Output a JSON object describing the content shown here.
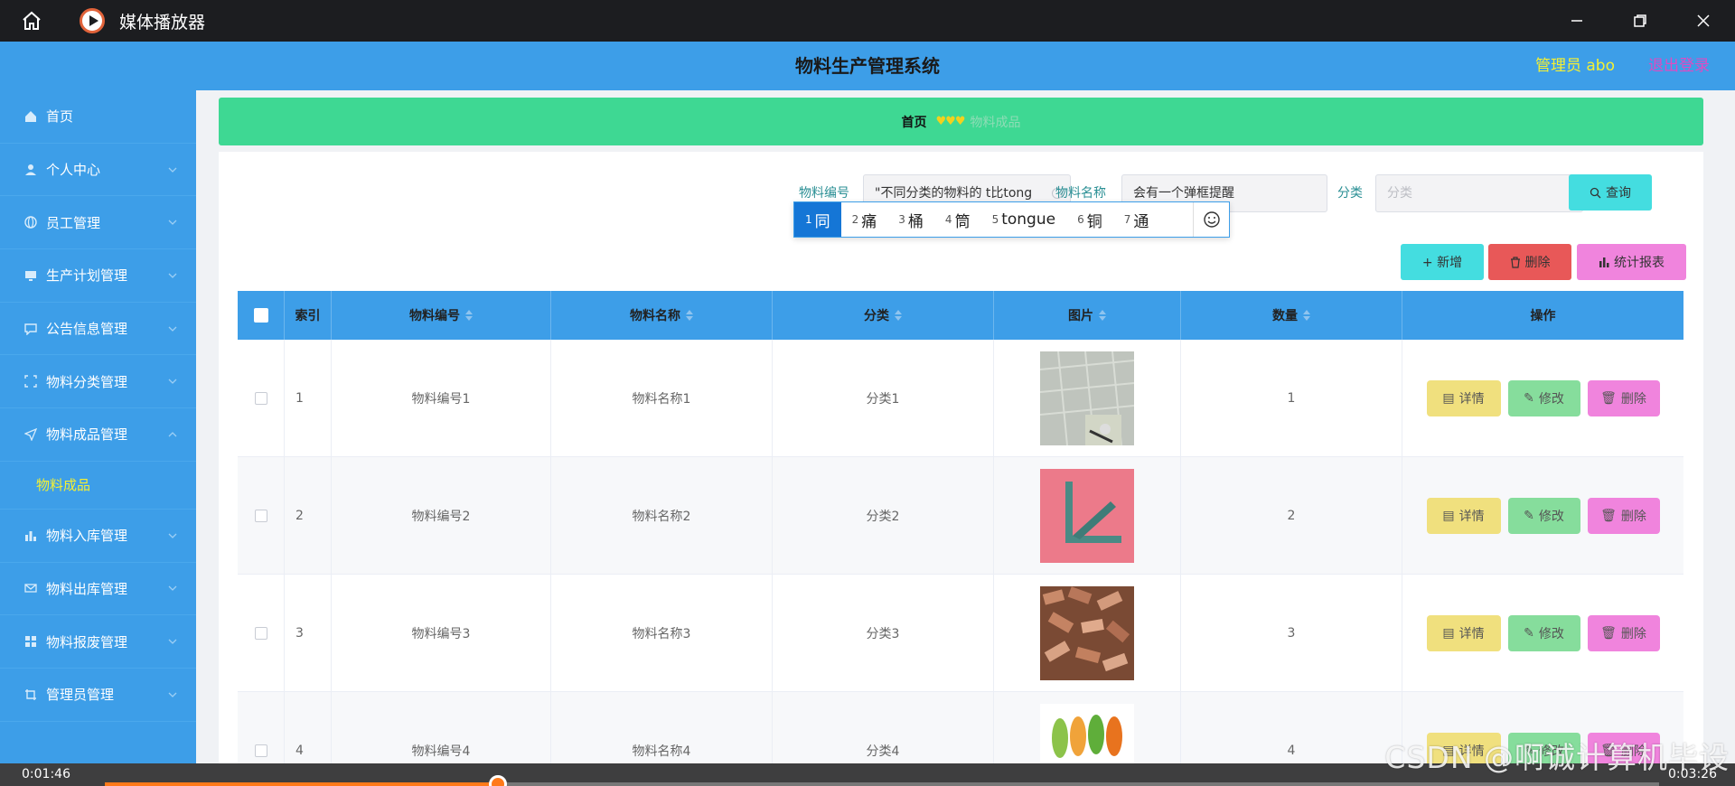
{
  "player": {
    "title": "媒体播放器",
    "time_current": "0:01:46",
    "time_total": "0:03:26",
    "progress": 0.253,
    "watermark": "CSDN @啊诚计算机毕设"
  },
  "header": {
    "title": "物料生产管理系统",
    "admin": "管理员 abo",
    "logout": "退出登录"
  },
  "sidebar": {
    "items": [
      {
        "label": "首页",
        "icon": "home-icon"
      },
      {
        "label": "个人中心",
        "icon": "user-icon"
      },
      {
        "label": "员工管理",
        "icon": "globe-icon"
      },
      {
        "label": "生产计划管理",
        "icon": "monitor-icon"
      },
      {
        "label": "公告信息管理",
        "icon": "chat-icon"
      },
      {
        "label": "物料分类管理",
        "icon": "frame-icon"
      },
      {
        "label": "物料成品管理",
        "icon": "send-icon"
      },
      {
        "label": "物料入库管理",
        "icon": "bar-chart-icon"
      },
      {
        "label": "物料出库管理",
        "icon": "mail-icon"
      },
      {
        "label": "物料报废管理",
        "icon": "grid-icon"
      },
      {
        "label": "管理员管理",
        "icon": "crop-icon"
      }
    ],
    "active_sub": "物料成品"
  },
  "breadcrumb": {
    "home": "首页",
    "hearts": "♥♥♥",
    "current": "物料成品"
  },
  "search": {
    "code_label": "物料编号",
    "code_value": "\"不同分类的物料的 t比tong",
    "name_label": "物料名称",
    "name_value": "会有一个弹框提醒",
    "category_label": "分类",
    "category_placeholder": "分类",
    "query_label": "查询"
  },
  "ime": {
    "candidates": [
      {
        "n": "1",
        "text": "同"
      },
      {
        "n": "2",
        "text": "痛"
      },
      {
        "n": "3",
        "text": "桶"
      },
      {
        "n": "4",
        "text": "筒"
      },
      {
        "n": "5",
        "text": "tongue"
      },
      {
        "n": "6",
        "text": "铜"
      },
      {
        "n": "7",
        "text": "通"
      }
    ]
  },
  "actions": {
    "add": "+ 新增",
    "delete": "删除",
    "report": "统计报表"
  },
  "table": {
    "headers": [
      "索引",
      "物料编号",
      "物料名称",
      "分类",
      "图片",
      "数量",
      "操作"
    ],
    "rows": [
      {
        "index": "1",
        "code": "物料编号1",
        "name": "物料名称1",
        "category": "分类1",
        "qty": "1"
      },
      {
        "index": "2",
        "code": "物料编号2",
        "name": "物料名称2",
        "category": "分类2",
        "qty": "2"
      },
      {
        "index": "3",
        "code": "物料编号3",
        "name": "物料名称3",
        "category": "分类3",
        "qty": "3"
      },
      {
        "index": "4",
        "code": "物料编号4",
        "name": "物料名称4",
        "category": "分类4",
        "qty": "4"
      }
    ],
    "btn_detail": "详情",
    "btn_edit": "修改",
    "btn_delete": "删除"
  }
}
